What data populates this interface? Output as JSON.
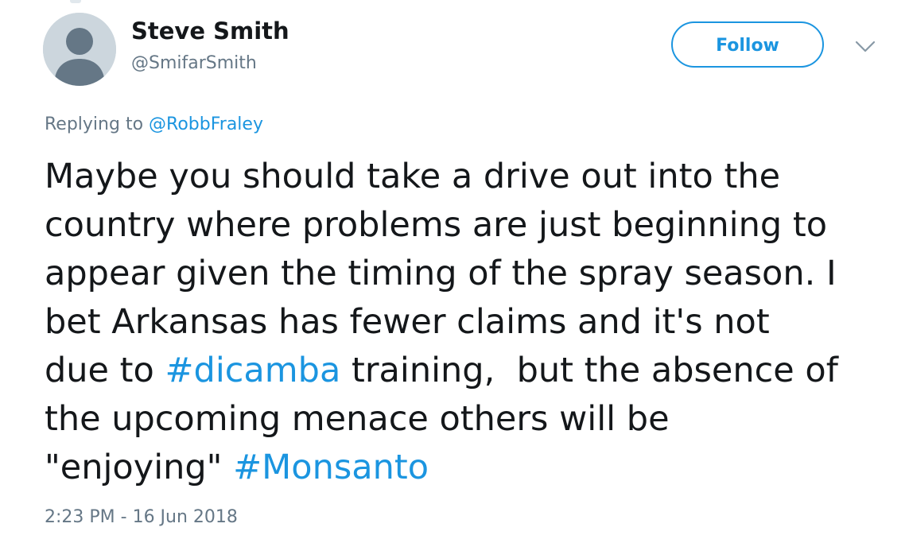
{
  "tweet": {
    "author": {
      "display_name": "Steve Smith",
      "handle": "@SmifarSmith",
      "avatar_icon": "default-avatar-icon"
    },
    "follow_label": "Follow",
    "menu_icon": "chevron-down-icon",
    "reply": {
      "prefix": "Replying to",
      "to_handle": "@RobbFraley"
    },
    "text_lines": [
      "Maybe you should take a drive out into the",
      "country where problems are just beginning to",
      "appear given the timing of the spray season. I",
      "bet Arkansas has fewer claims and it's not"
    ],
    "line5": {
      "before": "due to ",
      "hashtag": "#dicamba",
      "after": " training,  but the absence of"
    },
    "line6": "the upcoming menace others will be",
    "line7": {
      "before": "\"enjoying\" ",
      "hashtag": "#Monsanto"
    },
    "timestamp": "2:23 PM - 16 Jun 2018",
    "colors": {
      "accent": "#1b95e0",
      "secondary_text": "#657786",
      "primary_text": "#14171a",
      "avatar_bg": "#ccd6dd"
    }
  }
}
